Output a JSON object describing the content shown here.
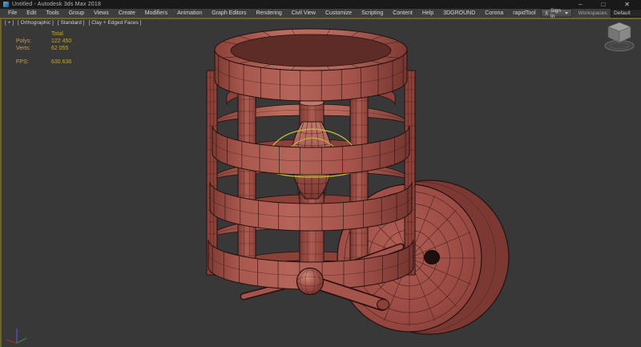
{
  "window": {
    "title": "Untitled - Autodesk 3ds Max 2018",
    "controls": {
      "minimize": "–",
      "maximize": "□",
      "close": "✕"
    }
  },
  "menu": {
    "items": [
      "File",
      "Edit",
      "Tools",
      "Group",
      "Views",
      "Create",
      "Modifiers",
      "Animation",
      "Graph Editors",
      "Rendering",
      "Civil View",
      "Customize",
      "Scripting",
      "Content",
      "Help",
      "3DGROUND",
      "Corona",
      "rapidTool"
    ]
  },
  "account": {
    "sign_in": "Sign In"
  },
  "workspaces": {
    "label": "Workspaces:",
    "value": "Default"
  },
  "viewport": {
    "labels": [
      "[ + ]",
      "[ Orthographic ]",
      "[ Standard ]",
      "[ Clay + Edged Faces ]"
    ],
    "statistics": {
      "header": "Total",
      "rows": [
        [
          "Polys:",
          "122 450"
        ],
        [
          "Verts:",
          "62 055"
        ]
      ],
      "fps": [
        "FPS:",
        "630.636"
      ]
    },
    "scene": {
      "description": "wireframe wall-sconce cage lamp shown in Clay + Edged Faces shading with an omni light gizmo",
      "colors": {
        "model_face": "#a5544b",
        "model_top": "#b4665a",
        "model_dark": "#8c4038",
        "model_darker": "#7c3933",
        "model_inner": "#5e2c27",
        "edge": "#241110",
        "gizmo": "#c2c23a",
        "background": "#383838",
        "active_border": "#6d6330",
        "stats_text": "#c9a33a",
        "axis_x": "#993028",
        "axis_y": "#3f7a36",
        "axis_z": "#4a55b5"
      }
    }
  }
}
